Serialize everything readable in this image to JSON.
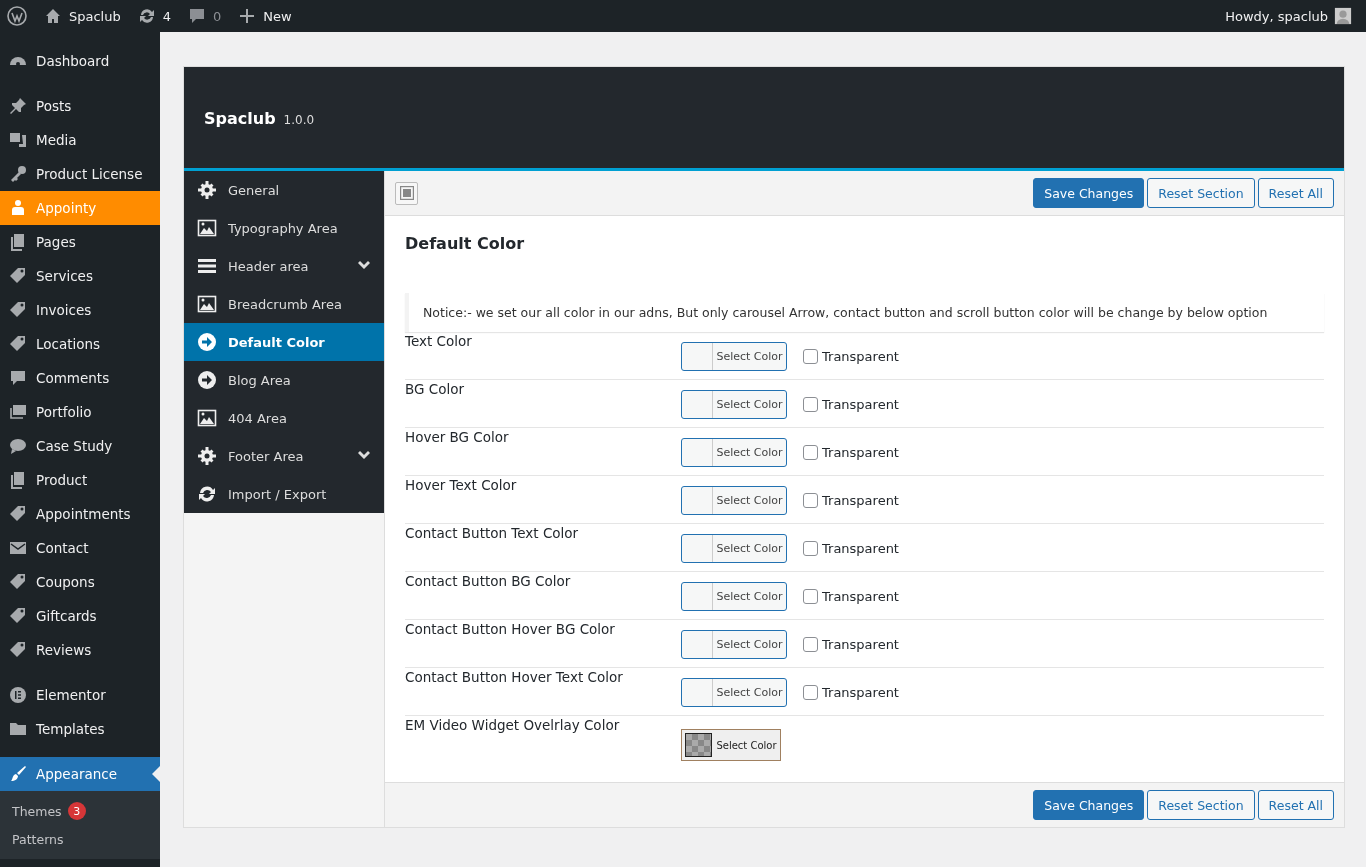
{
  "admin_bar": {
    "site": "Spaclub",
    "updates": "4",
    "comments": "0",
    "new": "New",
    "greeting": "Howdy, spaclub"
  },
  "admin_menu": {
    "groups": [
      {
        "items": [
          {
            "label": "Dashboard",
            "selected": false
          }
        ]
      },
      {
        "items": [
          {
            "label": "Posts",
            "selected": false
          },
          {
            "label": "Media",
            "selected": false
          },
          {
            "label": "Product License",
            "selected": false
          },
          {
            "label": "Appointy",
            "selected": true
          },
          {
            "label": "Pages",
            "selected": false
          },
          {
            "label": "Services",
            "selected": false
          },
          {
            "label": "Invoices",
            "selected": false
          },
          {
            "label": "Locations",
            "selected": false
          },
          {
            "label": "Comments",
            "selected": false
          },
          {
            "label": "Portfolio",
            "selected": false
          },
          {
            "label": "Case Study",
            "selected": false
          },
          {
            "label": "Product",
            "selected": false
          },
          {
            "label": "Appointments",
            "selected": false
          },
          {
            "label": "Contact",
            "selected": false
          },
          {
            "label": "Coupons",
            "selected": false
          },
          {
            "label": "Giftcards",
            "selected": false
          },
          {
            "label": "Reviews",
            "selected": false
          }
        ]
      },
      {
        "items": [
          {
            "label": "Elementor",
            "selected": false
          },
          {
            "label": "Templates",
            "selected": false
          }
        ]
      },
      {
        "items": [
          {
            "label": "Appearance",
            "current": true
          }
        ]
      }
    ],
    "submenu": [
      {
        "label": "Themes",
        "badge": "3"
      },
      {
        "label": "Patterns"
      }
    ]
  },
  "panel": {
    "title": "Spaclub",
    "version": "1.0.0",
    "sections": [
      {
        "label": "General",
        "selected": false,
        "expandable": false
      },
      {
        "label": "Typography Area",
        "selected": false,
        "expandable": false
      },
      {
        "label": "Header area",
        "selected": false,
        "expandable": true
      },
      {
        "label": "Breadcrumb Area",
        "selected": false,
        "expandable": false
      },
      {
        "label": "Default Color",
        "selected": true,
        "expandable": false
      },
      {
        "label": "Blog Area",
        "selected": false,
        "expandable": false
      },
      {
        "label": "404 Area",
        "selected": false,
        "expandable": false
      },
      {
        "label": "Footer Area",
        "selected": false,
        "expandable": true
      },
      {
        "label": "Import / Export",
        "selected": false,
        "expandable": false
      }
    ],
    "buttons": [
      "Save Changes",
      "Reset Section",
      "Reset All"
    ],
    "heading": "Default Color",
    "notice": "Notice:- we set our all color in our adns, But only carousel Arrow, contact button and scroll button color will be change by below option",
    "fields": [
      {
        "kind": "color",
        "label": "Text Color",
        "button": "Select Color",
        "transparent": "Transparent",
        "checked": false
      },
      {
        "kind": "color",
        "label": "BG Color",
        "button": "Select Color",
        "transparent": "Transparent",
        "checked": false
      },
      {
        "kind": "color",
        "label": "Hover BG Color",
        "button": "Select Color",
        "transparent": "Transparent",
        "checked": false
      },
      {
        "kind": "color",
        "label": "Hover Text Color",
        "button": "Select Color",
        "transparent": "Transparent",
        "checked": false
      },
      {
        "kind": "color",
        "label": "Contact Button Text Color",
        "button": "Select Color",
        "transparent": "Transparent",
        "checked": false
      },
      {
        "kind": "color",
        "label": "Contact Button BG Color",
        "button": "Select Color",
        "transparent": "Transparent",
        "checked": false
      },
      {
        "kind": "color",
        "label": "Contact Button Hover BG Color",
        "button": "Select Color",
        "transparent": "Transparent",
        "checked": false
      },
      {
        "kind": "color",
        "label": "Contact Button Hover Text Color",
        "button": "Select Color",
        "transparent": "Transparent",
        "checked": false
      },
      {
        "kind": "alpha",
        "label": "EM Video Widget Ovelrlay Color",
        "button": "Select Color"
      }
    ],
    "footer_buttons": [
      "Save Changes",
      "Reset Section",
      "Reset All"
    ]
  }
}
